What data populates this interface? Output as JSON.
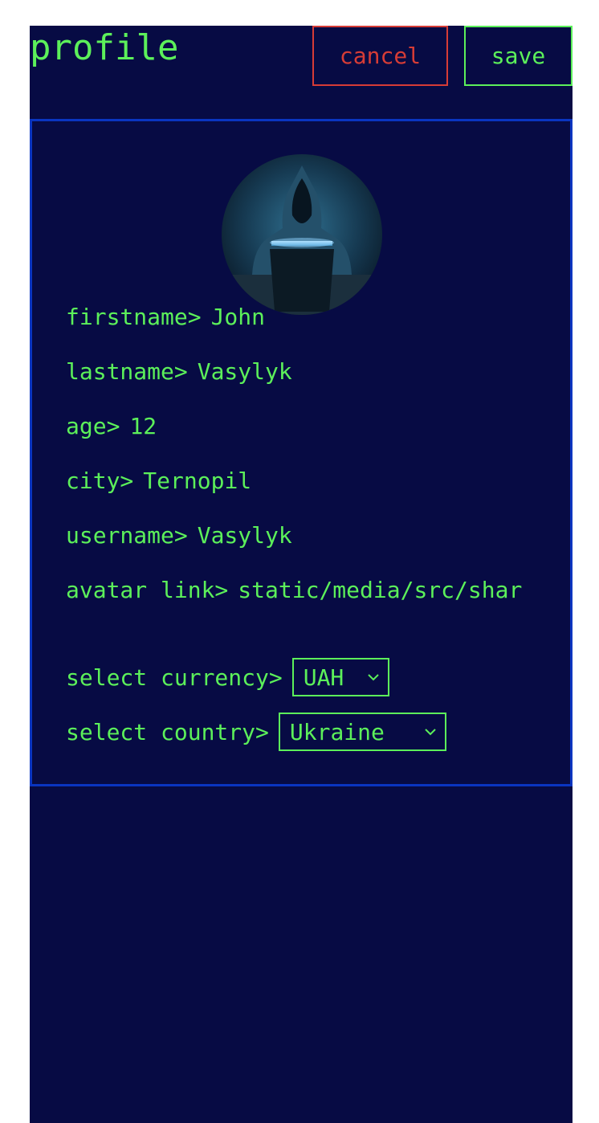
{
  "header": {
    "title": "profile",
    "cancel_label": "cancel",
    "save_label": "save"
  },
  "profile": {
    "firstname": {
      "label": "firstname>",
      "value": "John"
    },
    "lastname": {
      "label": "lastname>",
      "value": "Vasylyk"
    },
    "age": {
      "label": "age>",
      "value": "12"
    },
    "city": {
      "label": "city>",
      "value": "Ternopil"
    },
    "username": {
      "label": "username>",
      "value": "Vasylyk"
    },
    "avatar_link": {
      "label": "avatar link>",
      "value": "static/media/src/shar"
    },
    "currency": {
      "label": "select currency>",
      "selected": "UAH"
    },
    "country": {
      "label": "select country>",
      "selected": "Ukraine"
    }
  },
  "icons": {
    "avatar": "hooded-figure-laptop-avatar",
    "dropdown": "chevron-down-icon"
  },
  "colors": {
    "background": "#070b44",
    "text": "#5cf05a",
    "cancel": "#d63c36",
    "card_border": "#0a35c0"
  }
}
